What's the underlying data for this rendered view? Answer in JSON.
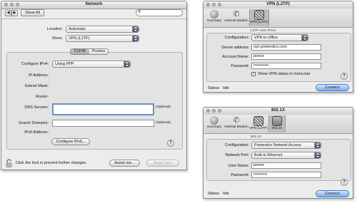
{
  "network": {
    "title": "Network",
    "show_all": "Show All",
    "location_label": "Location:",
    "location_value": "Automatic",
    "show_label": "Show:",
    "show_value": "VPN (L2TP)",
    "tabs": [
      "TCP/IP",
      "Proxies"
    ],
    "configure_ipv4_label": "Configure IPv4:",
    "configure_ipv4_value": "Using PPP",
    "ip_address_label": "IP Address:",
    "subnet_mask_label": "Subnet Mask:",
    "router_label": "Router:",
    "dns_servers_label": "DNS Servers:",
    "optional_1": "(Optional)",
    "search_domains_label": "Search Domains:",
    "optional_2": "(Optional)",
    "ipv6_address_label": "IPv6 Address:",
    "configure_ipv6_button": "Configure IPv6...",
    "help": "?",
    "lock_text": "Click the lock to prevent further changes.",
    "assist_button": "Assist me...",
    "apply_button": "Apply Now"
  },
  "vpn": {
    "title": "VPN (L2TP)",
    "toolbar": [
      "Summary",
      "Internal Modem",
      "VPN (L2TP)"
    ],
    "section_label": "L2TP over IPSec",
    "configuration_label": "Configuration:",
    "configuration_value": "VPN to Office",
    "server_label": "Server address:",
    "server_value": "vpn.pretendco.com",
    "account_label": "Account Name:",
    "account_value": "peece",
    "password_label": "Password:",
    "password_value": "•••••••••••",
    "show_status_label": "Show VPN status in menu bar",
    "help": "?",
    "status_label": "Status:",
    "status_value": "Idle",
    "connect_button": "Connect"
  },
  "dot1x": {
    "title": "802.1X",
    "toolbar": [
      "Summary",
      "Internal Modem",
      "VPN (L2TP)",
      "802.1X"
    ],
    "section_label": "802.1X",
    "configuration_label": "Configuration:",
    "configuration_value": "Pretendco Network Access",
    "port_label": "Network Port:",
    "port_value": "Built-in Ethernet",
    "user_label": "User Name:",
    "user_value": "peece",
    "password_label": "Password:",
    "password_value": "••••••••••",
    "help": "?",
    "status_label": "Status:",
    "status_value": "Idle",
    "connect_button": "Connect"
  }
}
